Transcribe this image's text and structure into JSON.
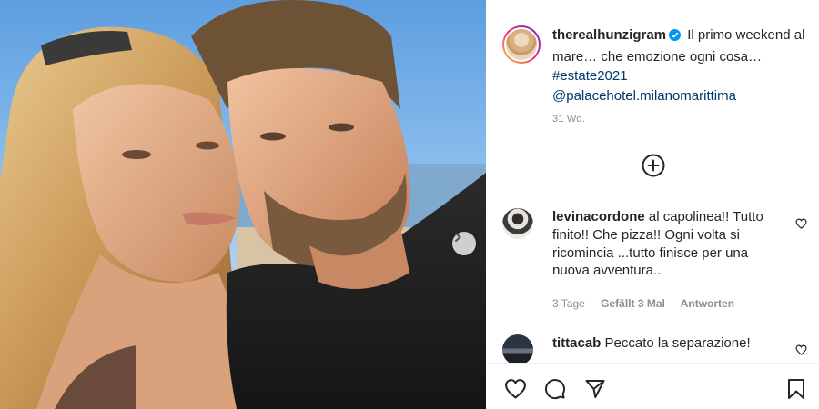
{
  "post": {
    "image_alt_subject": "",
    "author": "therealhunzigram",
    "verified": true,
    "caption_line1": "Il primo weekend al mare... che emozione ogni cosa...",
    "caption_main": " Il primo weekend al mare…",
    "caption_cont": "che emozione ogni cosa…",
    "hashtag": "#estate2021",
    "mention": "@palacehotel.milanomarittima",
    "age": "31 Wo."
  },
  "comments": [
    {
      "username": "levinacordone",
      "text": "al capolinea!! Tutto finito!! Che pizza!! Ogni volta si ricomincia ...tutto finisce per una nuova avventura..",
      "date": "3 Tage",
      "likes": "Gefällt 3 Mal",
      "reply": "Antworten"
    },
    {
      "username": "tittacab",
      "text": "Peccato la separazione!"
    }
  ],
  "icons": {
    "verified": "verified-badge-icon",
    "load_more": "plus-circle-icon",
    "carousel": "chevron-right-icon",
    "like": "heart-icon",
    "comment": "comment-icon",
    "share": "paper-plane-icon",
    "save": "bookmark-icon"
  },
  "colors": {
    "verified": "#0095f6",
    "link": "#00376b",
    "muted": "#8e8e8e",
    "text": "#262626"
  }
}
